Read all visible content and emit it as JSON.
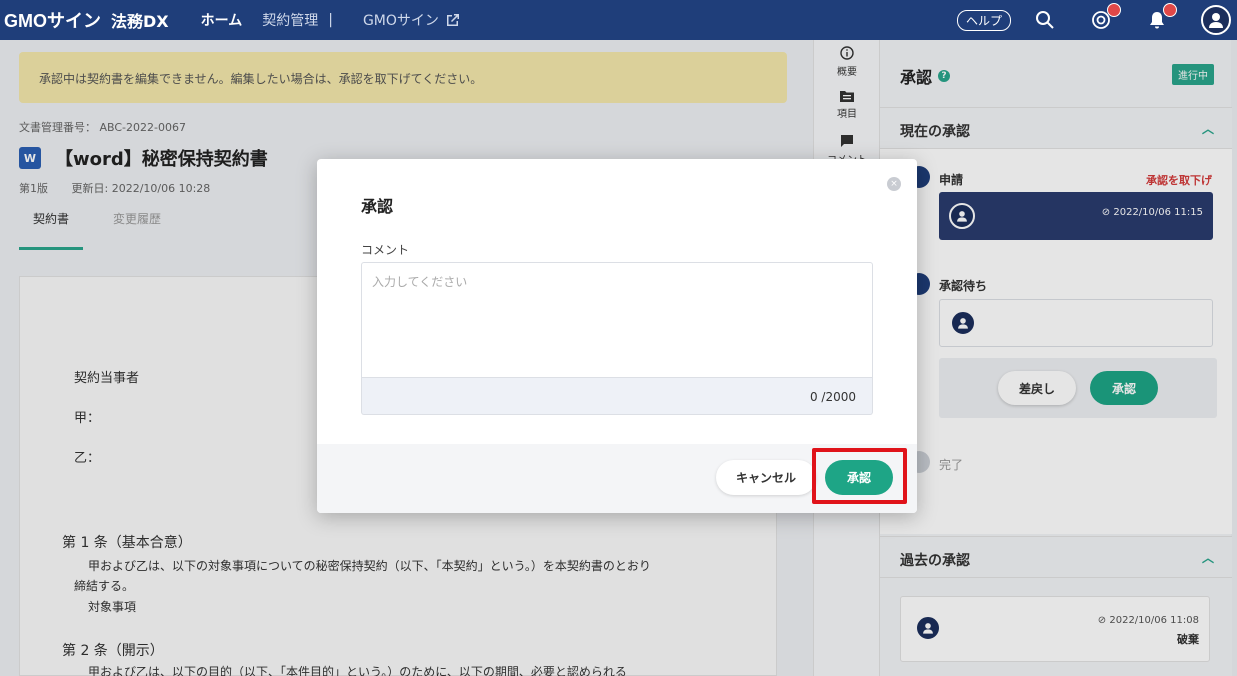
{
  "colors": {
    "nav_bg": "#1f3e7a",
    "accent_green": "#1ea586",
    "notice_bg": "#f4e8ac",
    "withdraw_red": "#d43a3a",
    "highlight_red": "#e0131a"
  },
  "nav": {
    "logo": "GMOサイン",
    "product": "法務DX",
    "links": [
      "ホーム",
      "契約管理",
      "GMOサイン"
    ],
    "separator": "|",
    "help": "ヘルプ",
    "icons": [
      "external-link-icon",
      "search-icon",
      "mention-icon",
      "bell-icon",
      "user-avatar-icon"
    ]
  },
  "notice": "承認中は契約書を編集できません。編集したい場合は、承認を取下げてください。",
  "document": {
    "number": "文書管理番号： ABC-2022-0067",
    "icon_letter": "W",
    "title": "【word】秘密保持契約書",
    "version": "第1版",
    "updated": "更新日: 2022/10/06 10:28",
    "tabs": [
      "契約書",
      "変更履歴"
    ]
  },
  "paper": {
    "parties_title": "契約当事者",
    "party_a": "甲：",
    "party_b": "乙：",
    "article1_title": "第 1 条（基本合意）",
    "article1_line1": "甲および乙は、以下の対象事項についての秘密保持契約（以下、「本契約」という。）を本契約書のとおり",
    "article1_line2": "締結する。",
    "article1_line3": "対象事項",
    "article2_title": "第 2 条（開示）",
    "article2_line1": "甲および乙は、以下の目的（以下、「本件目的」という。）のために、以下の期間、必要と認められる"
  },
  "side_icons": [
    {
      "label": "概要",
      "icon": "info-icon"
    },
    {
      "label": "項目",
      "icon": "folder-icon"
    },
    {
      "label": "コメント",
      "icon": "comment-icon"
    }
  ],
  "approval_panel": {
    "title": "承認",
    "help_icon": "?",
    "status": "進行中",
    "current_section": "現在の承認",
    "steps": {
      "apply": "申請",
      "withdraw": "承認を取下げ",
      "apply_time": "2022/10/06 11:15",
      "waiting": "承認待ち",
      "send_back": "差戻し",
      "approve": "承認",
      "done": "完了"
    },
    "past_section": "過去の承認",
    "past_time": "2022/10/06 11:08",
    "past_status": "破棄"
  },
  "modal": {
    "title": "承認",
    "close": "×",
    "comment_label": "コメント",
    "comment_placeholder": "入力してください",
    "comment_value": "",
    "counter": "0 /2000",
    "cancel": "キャンセル",
    "approve": "承認"
  }
}
